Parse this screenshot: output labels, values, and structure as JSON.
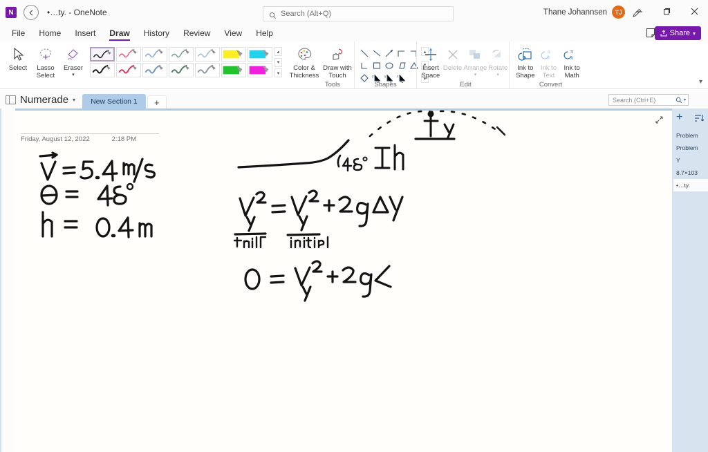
{
  "titlebar": {
    "logo_text": "N",
    "back_icon": "back-arrow-icon",
    "window_title": "•…ty.  -  OneNote",
    "search": {
      "placeholder": "Search (Alt+Q)",
      "icon": "search-icon"
    },
    "user_name": "Thane Johannsen",
    "avatar_initials": "TJ",
    "avatar_color": "#e06c19",
    "pen_icon": "pen-icon",
    "minimize": "minimize-icon",
    "restore": "restore-icon",
    "close": "close-icon"
  },
  "menu": {
    "tabs": [
      {
        "label": "File",
        "active": false
      },
      {
        "label": "Home",
        "active": false
      },
      {
        "label": "Insert",
        "active": false
      },
      {
        "label": "Draw",
        "active": true
      },
      {
        "label": "History",
        "active": false
      },
      {
        "label": "Review",
        "active": false
      },
      {
        "label": "View",
        "active": false
      },
      {
        "label": "Help",
        "active": false
      }
    ],
    "sticky_note_icon": "sticky-note-icon",
    "share_label": "Share",
    "share_icon": "share-icon",
    "share_chevron": "▾",
    "share_color": "#7719aa"
  },
  "ribbon": {
    "groups": [
      {
        "name": "Tools",
        "label": "Tools",
        "buttons": [
          {
            "label": "Select",
            "icon": "cursor-arrow-icon",
            "enabled": true
          },
          {
            "label": "Lasso\nSelect",
            "icon": "lasso-select-icon",
            "enabled": true
          },
          {
            "label": "Eraser",
            "icon": "eraser-icon",
            "enabled": true,
            "has_chevron": true
          }
        ],
        "pens": [
          {
            "name": "pen-black",
            "color": "#1b1b1b",
            "type": "pen",
            "selected": true
          },
          {
            "name": "pen-red",
            "color": "#e8537a",
            "type": "pen",
            "selected": false
          },
          {
            "name": "pen-blue",
            "color": "#7fa5d4",
            "type": "pen",
            "selected": false
          },
          {
            "name": "pen-green",
            "color": "#6fa08a",
            "type": "pen",
            "selected": false
          },
          {
            "name": "pen-lightblue",
            "color": "#9fb9d6",
            "type": "pen",
            "selected": false
          },
          {
            "name": "highlighter-yellow",
            "color": "#fcee21",
            "type": "highlighter",
            "selected": false
          },
          {
            "name": "highlighter-cyan",
            "color": "#22d3ee",
            "type": "highlighter",
            "selected": false
          },
          {
            "name": "pen-black-2",
            "color": "#1b1b1b",
            "type": "pen",
            "selected": false
          },
          {
            "name": "pen-red-2",
            "color": "#e0315e",
            "type": "pen",
            "selected": false
          },
          {
            "name": "pen-blue-2",
            "color": "#6f96c8",
            "type": "pen",
            "selected": false
          },
          {
            "name": "pen-green-2",
            "color": "#4e7f66",
            "type": "pen",
            "selected": false
          },
          {
            "name": "pen-gray-2",
            "color": "#8d9aa8",
            "type": "pen",
            "selected": false
          },
          {
            "name": "highlighter-green",
            "color": "#22c32e",
            "type": "highlighter",
            "selected": false
          },
          {
            "name": "highlighter-magenta",
            "color": "#ee22dd",
            "type": "highlighter",
            "selected": false
          }
        ],
        "extra_buttons": [
          {
            "label": "Color &\nThickness",
            "icon": "color-palette-icon",
            "enabled": true
          },
          {
            "label": "Draw with\nTouch",
            "icon": "draw-with-touch-icon",
            "enabled": true
          }
        ]
      },
      {
        "name": "Shapes",
        "label": "Shapes",
        "shape_icons": [
          "line-diagonal-icon",
          "line-diagonal2-icon",
          "arrow-diagonal-icon",
          "corner-up-icon",
          "corner-right-icon",
          "elbow-icon",
          "square-icon",
          "ellipse-icon",
          "parallelogram-icon",
          "triangle-icon",
          "diamond-icon",
          "axis-xy-icon",
          "axis-xy2-icon",
          "axis-xyz-icon"
        ]
      },
      {
        "name": "Edit",
        "label": "Edit",
        "buttons": [
          {
            "label": "Insert\nSpace",
            "icon": "insert-space-icon",
            "enabled": true
          },
          {
            "label": "Delete",
            "icon": "delete-x-icon",
            "enabled": false
          },
          {
            "label": "Arrange",
            "icon": "arrange-icon",
            "enabled": false,
            "has_chevron": true
          },
          {
            "label": "Rotate",
            "icon": "rotate-icon",
            "enabled": false,
            "has_chevron": true
          }
        ]
      },
      {
        "name": "Convert",
        "label": "Convert",
        "buttons": [
          {
            "label": "Ink to\nShape",
            "icon": "ink-to-shape-icon",
            "enabled": true
          },
          {
            "label": "Ink to\nText",
            "icon": "ink-to-text-icon",
            "enabled": false
          },
          {
            "label": "Ink to\nMath",
            "icon": "ink-to-math-icon",
            "enabled": true
          }
        ]
      }
    ],
    "collapse_icon": "chevron-up-icon"
  },
  "notebook_bar": {
    "notebook_name": "Numerade",
    "notebook_icon": "notebook-icon",
    "notebook_chevron": "▾",
    "sections": [
      {
        "label": "New Section 1",
        "active": true
      }
    ],
    "add_section_label": "+",
    "search_placeholder": "Search (Ctrl+E)",
    "search_icon": "search-icon",
    "search_chevron": "▾"
  },
  "page": {
    "date": "Friday, August 12, 2022",
    "time": "2:18 PM",
    "expand_icon": "expand-arrows-icon",
    "ink_notes": {
      "given": [
        {
          "text": "V⃗ = 5.4 m/s"
        },
        {
          "text": "θ = 48°"
        },
        {
          "text": "h = 0.4 m"
        }
      ],
      "diagram": {
        "angle_label": "48°",
        "height_label": "h",
        "vertical_label": "y",
        "figure": "stick-figure"
      },
      "equations": [
        {
          "text": "V_y² = V_y² + 2g Δy",
          "sub_left": "final",
          "sub_right": "initial"
        },
        {
          "text": "0 = V_y² + 2g ∠"
        }
      ]
    }
  },
  "page_panel": {
    "add_page_label": "+",
    "sort_icon": "sort-pages-icon",
    "pages": [
      {
        "label": "Problem",
        "selected": false
      },
      {
        "label": "Problem",
        "selected": false
      },
      {
        "label": "Y",
        "selected": false
      },
      {
        "label": "8.7×103",
        "selected": false
      },
      {
        "label": "•…ty.",
        "selected": true
      }
    ]
  }
}
